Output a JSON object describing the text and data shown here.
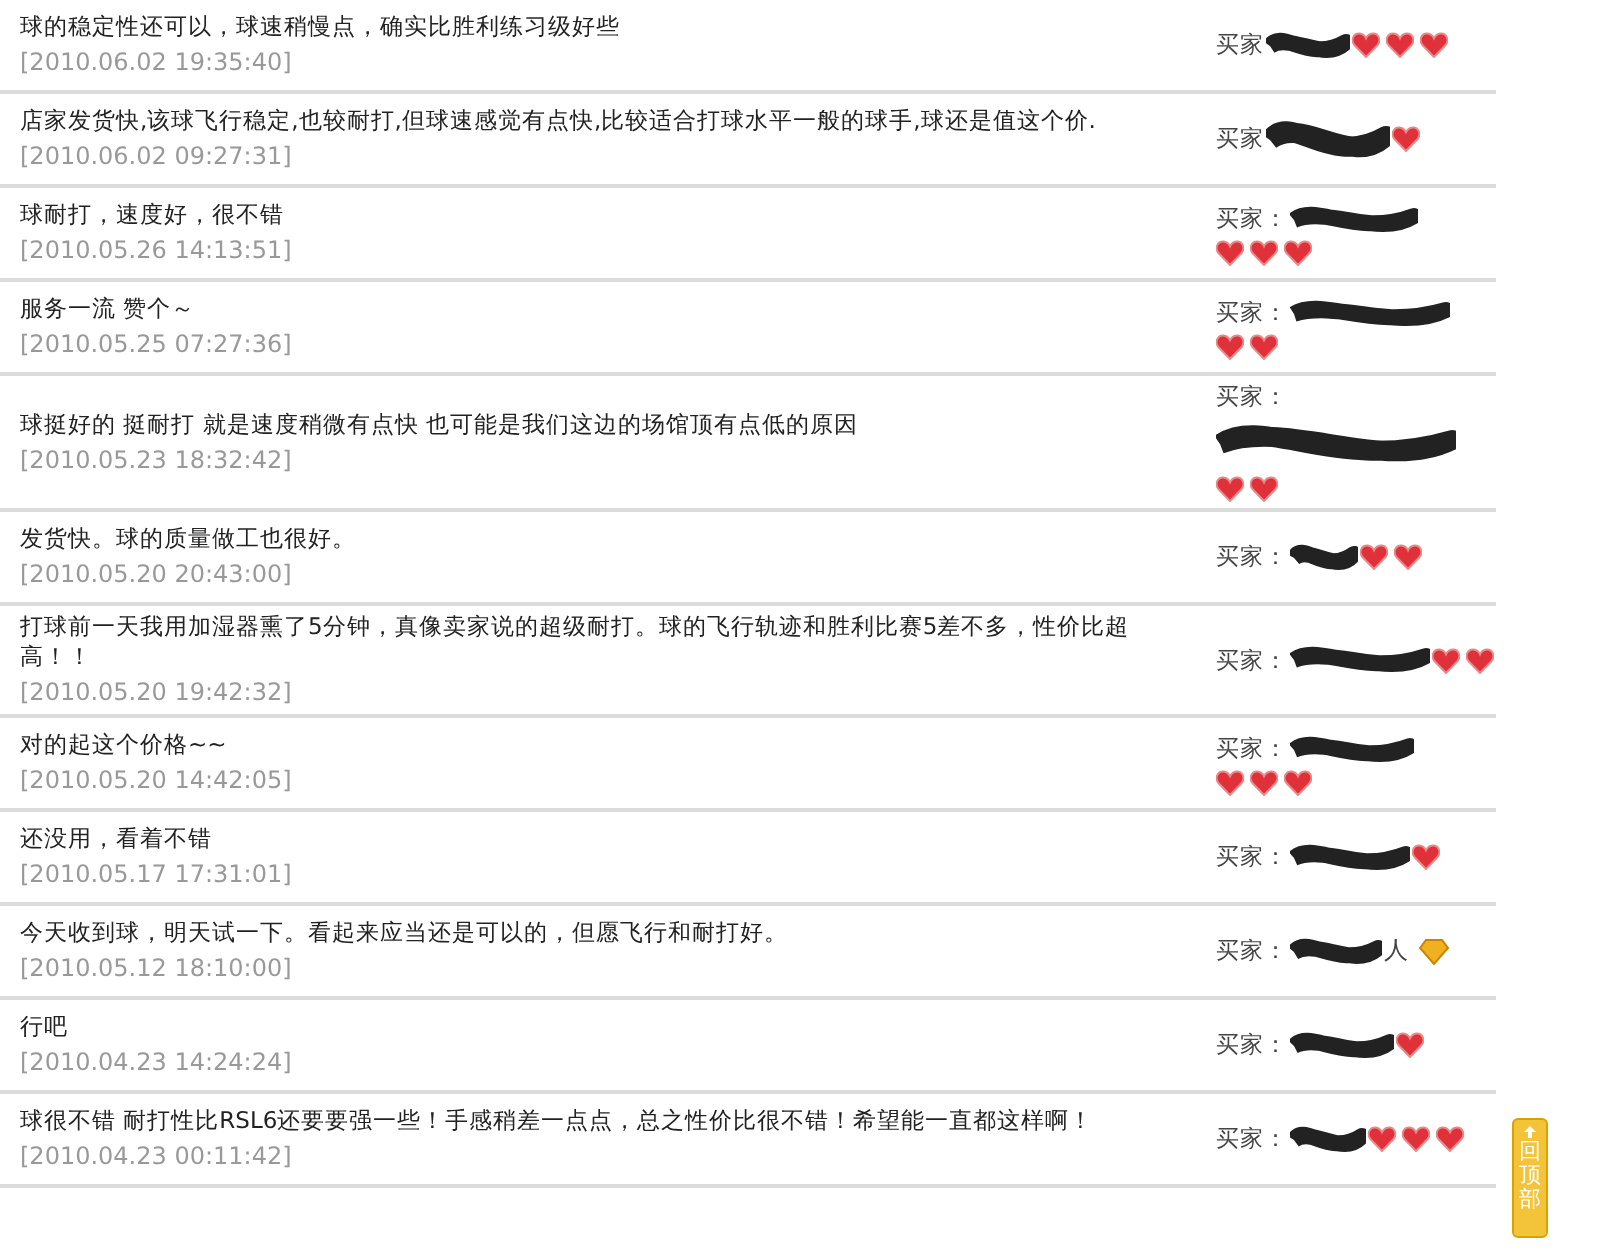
{
  "reviews": [
    {
      "comment": "球的稳定性还可以，球速稍慢点，确实比胜利练习级好些",
      "date": "[2010.06.02 19:35:40]",
      "buyer_label": "买家",
      "rank_icons": [
        {
          "kind": "heart"
        },
        {
          "kind": "heart"
        },
        {
          "kind": "heart"
        }
      ]
    },
    {
      "comment": "店家发货快,该球飞行稳定,也较耐打,但球速感觉有点快,比较适合打球水平一般的球手,球还是值这个价.",
      "date": "[2010.06.02 09:27:31]",
      "buyer_label": "买家",
      "rank_icons": [
        {
          "kind": "heart"
        }
      ]
    },
    {
      "comment": "球耐打，速度好，很不错",
      "date": "[2010.05.26 14:13:51]",
      "buyer_label": "买家：",
      "rank_icons": [
        {
          "kind": "heart"
        },
        {
          "kind": "heart"
        },
        {
          "kind": "heart"
        }
      ]
    },
    {
      "comment": "服务一流 赞个～",
      "date": "[2010.05.25 07:27:36]",
      "buyer_label": "买家：",
      "rank_icons": [
        {
          "kind": "heart"
        },
        {
          "kind": "heart"
        }
      ]
    },
    {
      "comment": "球挺好的 挺耐打 就是速度稍微有点快 也可能是我们这边的场馆顶有点低的原因",
      "date": "[2010.05.23 18:32:42]",
      "buyer_label": "买家：",
      "rank_icons": [
        {
          "kind": "heart"
        },
        {
          "kind": "heart"
        }
      ]
    },
    {
      "comment": "发货快。球的质量做工也很好。",
      "date": "[2010.05.20 20:43:00]",
      "buyer_label": "买家：",
      "rank_icons": [
        {
          "kind": "heart"
        },
        {
          "kind": "heart"
        }
      ]
    },
    {
      "comment": "打球前一天我用加湿器熏了5分钟，真像卖家说的超级耐打。球的飞行轨迹和胜利比赛5差不多，性价比超高！！",
      "date": "[2010.05.20 19:42:32]",
      "buyer_label": "买家：",
      "rank_icons": [
        {
          "kind": "heart"
        },
        {
          "kind": "heart"
        }
      ]
    },
    {
      "comment": "对的起这个价格~~",
      "date": "[2010.05.20 14:42:05]",
      "buyer_label": "买家：",
      "rank_icons": [
        {
          "kind": "heart"
        },
        {
          "kind": "heart"
        },
        {
          "kind": "heart"
        }
      ]
    },
    {
      "comment": "还没用，看着不错",
      "date": "[2010.05.17 17:31:01]",
      "buyer_label": "买家：",
      "rank_icons": [
        {
          "kind": "heart"
        }
      ]
    },
    {
      "comment": "今天收到球，明天试一下。看起来应当还是可以的，但愿飞行和耐打好。",
      "date": "[2010.05.12 18:10:00]",
      "buyer_label": "买家：",
      "buyer_tail": "人",
      "rank_icons": [
        {
          "kind": "diamond"
        }
      ]
    },
    {
      "comment": "行吧",
      "date": "[2010.04.23 14:24:24]",
      "buyer_label": "买家：",
      "rank_icons": [
        {
          "kind": "heart"
        }
      ]
    },
    {
      "comment": "球很不错 耐打性比RSL6还要要强一些！手感稍差一点点，总之性价比很不错！希望能一直都这样啊！",
      "date": "[2010.04.23 00:11:42]",
      "buyer_label": "买家：",
      "rank_icons": [
        {
          "kind": "heart"
        },
        {
          "kind": "heart"
        },
        {
          "kind": "heart"
        }
      ]
    }
  ],
  "back_to_top": {
    "label": "回顶部"
  }
}
